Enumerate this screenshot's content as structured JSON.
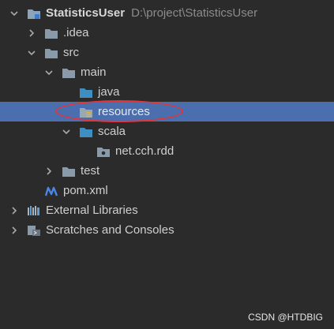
{
  "project": {
    "name": "StatisticsUser",
    "path": "D:\\project\\StatisticsUser"
  },
  "nodes": {
    "idea": ".idea",
    "src": "src",
    "main": "main",
    "java": "java",
    "resources": "resources",
    "scala": "scala",
    "package": "net.cch.rdd",
    "test": "test",
    "pom": "pom.xml",
    "external_libraries": "External Libraries",
    "scratches": "Scratches and Consoles"
  },
  "watermark": "CSDN @HTDBIG"
}
